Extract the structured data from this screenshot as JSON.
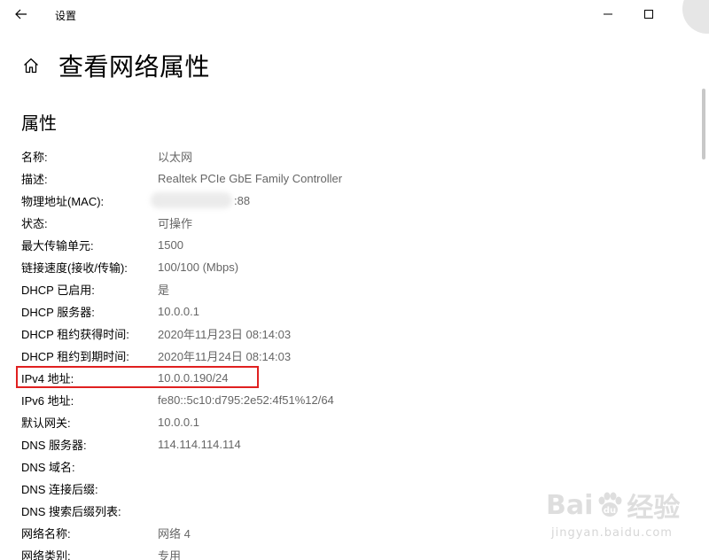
{
  "window": {
    "app_title": "设置"
  },
  "header": {
    "page_title": "查看网络属性"
  },
  "section": {
    "title": "属性"
  },
  "properties": [
    {
      "label": "名称:",
      "value": "以太网"
    },
    {
      "label": "描述:",
      "value": "Realtek PCIe GbE Family Controller"
    },
    {
      "label": "物理地址(MAC):",
      "value": ":88"
    },
    {
      "label": "状态:",
      "value": "可操作"
    },
    {
      "label": "最大传输单元:",
      "value": "1500"
    },
    {
      "label": "链接速度(接收/传输):",
      "value": "100/100 (Mbps)"
    },
    {
      "label": "DHCP 已启用:",
      "value": "是"
    },
    {
      "label": "DHCP 服务器:",
      "value": "10.0.0.1"
    },
    {
      "label": "DHCP 租约获得时间:",
      "value": "2020年11月23日 08:14:03"
    },
    {
      "label": "DHCP 租约到期时间:",
      "value": "2020年11月24日 08:14:03"
    },
    {
      "label": "IPv4 地址:",
      "value": "10.0.0.190/24"
    },
    {
      "label": "IPv6 地址:",
      "value": "fe80::5c10:d795:2e52:4f51%12/64"
    },
    {
      "label": "默认网关:",
      "value": "10.0.0.1"
    },
    {
      "label": "DNS 服务器:",
      "value": "114.114.114.114"
    },
    {
      "label": "DNS 域名:",
      "value": ""
    },
    {
      "label": "DNS 连接后缀:",
      "value": ""
    },
    {
      "label": "DNS 搜索后缀列表:",
      "value": ""
    },
    {
      "label": "网络名称:",
      "value": "网络 4"
    },
    {
      "label": "网络类别:",
      "value": "专用"
    }
  ],
  "watermark": {
    "logo_text_left": "Bai",
    "logo_text_right": "经验",
    "url": "jingyan.baidu.com"
  },
  "colors": {
    "highlight": "#e02020",
    "value_text": "#666666"
  }
}
